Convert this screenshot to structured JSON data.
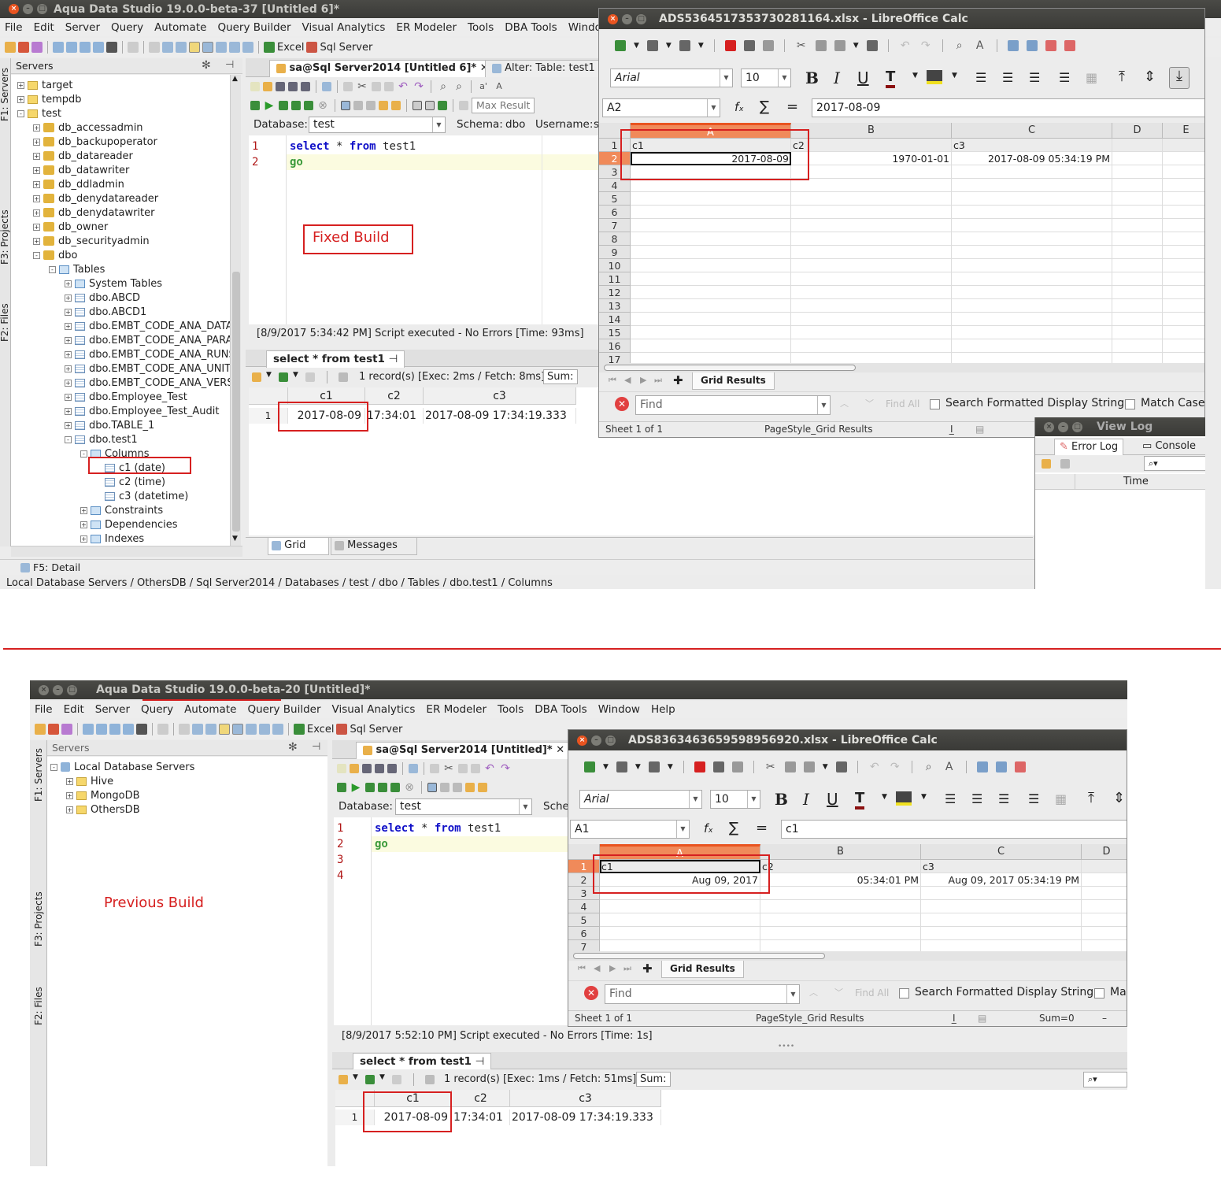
{
  "colors": {
    "red": "#d62020",
    "accent": "#e95420",
    "keyword": "#1010c8",
    "go": "#3a9a3a"
  },
  "top": {
    "ads_title": "Aqua Data Studio 19.0.0-beta-37 [Untitled 6]*",
    "menu": [
      "File",
      "Edit",
      "Server",
      "Query",
      "Automate",
      "Query Builder",
      "Visual Analytics",
      "ER Modeler",
      "Tools",
      "DBA Tools",
      "Window"
    ],
    "toolbar_excel": "Excel",
    "toolbar_sql_server": "Sql Server",
    "servers_label": "Servers",
    "side_tabs": [
      "F1: Servers",
      "F3: Projects",
      "F2: Files"
    ],
    "tree": [
      "target",
      "tempdb",
      "test",
      "db_accessadmin",
      "db_backupoperator",
      "db_datareader",
      "db_datawriter",
      "db_ddladmin",
      "db_denydatareader",
      "db_denydatawriter",
      "db_owner",
      "db_securityadmin",
      "dbo",
      "Tables",
      "System Tables",
      "dbo.ABCD",
      "dbo.ABCD1",
      "dbo.EMBT_CODE_ANA_DATA",
      "dbo.EMBT_CODE_ANA_PARA",
      "dbo.EMBT_CODE_ANA_RUNS",
      "dbo.EMBT_CODE_ANA_UNITS",
      "dbo.EMBT_CODE_ANA_VERS",
      "dbo.Employee_Test",
      "dbo.Employee_Test_Audit",
      "dbo.TABLE_1",
      "dbo.test1",
      "Columns",
      "c1 (date)",
      "c2 (time)",
      "c3 (datetime)",
      "Constraints",
      "Dependencies",
      "Indexes"
    ],
    "detail_tab": "F5: Detail",
    "breadcrumb": "Local Database Servers / OthersDB / Sql Server2014 / Databases / test / dbo / Tables / dbo.test1 / Columns",
    "editor_tab": "sa@Sql Server2014 [Untitled 6]*",
    "alter_tab": "Alter: Table: test1",
    "database_label": "Database:",
    "database_value": "test",
    "schema_label": "Schema:",
    "schema_value": "dbo",
    "username_label": "Username:",
    "username_value": "s",
    "max_results": "Max Result",
    "line_numbers": [
      "1",
      "2"
    ],
    "code_kw1": "select",
    "code_star": " * ",
    "code_kw2": "from",
    "code_tbl": " test1",
    "code_go": "go",
    "annotation": "Fixed Build",
    "exec_status": "[8/9/2017 5:34:42 PM] Script executed - No Errors [Time: 93ms]",
    "results_tab": "select * from test1",
    "records": "1 record(s) [Exec: 2ms / Fetch: 8ms]",
    "sum": "Sum:",
    "cols": [
      "c1",
      "c2",
      "c3"
    ],
    "row_num": "1",
    "row": [
      "2017-08-09",
      "17:34:01",
      "2017-08-09 17:34:19.333"
    ],
    "bottom_tabs": [
      "Grid",
      "Messages"
    ],
    "calc": {
      "title": "ADS5364517353730281164.xlsx - LibreOffice Calc",
      "font": "Arial",
      "size": "10",
      "cellref": "A2",
      "formula": "2017-08-09",
      "col_letters": [
        "A",
        "B",
        "C",
        "D",
        "E"
      ],
      "rows": [
        "1",
        "2",
        "3",
        "4",
        "5",
        "6",
        "7",
        "8",
        "9",
        "10",
        "11",
        "12",
        "13",
        "14",
        "15",
        "16",
        "17"
      ],
      "r1": [
        "c1",
        "c2",
        "c3"
      ],
      "r2": [
        "2017-08-09",
        "1970-01-01",
        "2017-08-09 05:34:19 PM"
      ],
      "sheet_tab": "Grid Results",
      "find_placeholder": "Find",
      "find_all": "Find All",
      "search_fmt": "Search Formatted Display String",
      "match_case": "Match Case",
      "sheet_of": "Sheet 1 of 1",
      "page_style": "PageStyle_Grid Results"
    },
    "viewlog": {
      "title": "View Log",
      "tabs": [
        "Error Log",
        "Console"
      ],
      "time_col": "Time"
    }
  },
  "bottom": {
    "ads_title": "Aqua Data Studio 19.0.0-beta-20 [Untitled]*",
    "menu": [
      "File",
      "Edit",
      "Server",
      "Query",
      "Automate",
      "Query Builder",
      "Visual Analytics",
      "ER Modeler",
      "Tools",
      "DBA Tools",
      "Window",
      "Help"
    ],
    "toolbar_excel": "Excel",
    "toolbar_sql_server": "Sql Server",
    "servers_label": "Servers",
    "side_tabs": [
      "F1: Servers",
      "F3: Projects",
      "F2: Files"
    ],
    "tree": [
      "Local Database Servers",
      "Hive",
      "MongoDB",
      "OthersDB"
    ],
    "editor_tab": "sa@Sql Server2014 [Untitled]*",
    "database_label": "Database:",
    "database_value": "test",
    "schema_short": "Sche",
    "line_numbers": [
      "1",
      "2",
      "3",
      "4"
    ],
    "code_kw1": "select",
    "code_star": " * ",
    "code_kw2": "from",
    "code_tbl": " test1",
    "code_go": "go",
    "annotation": "Previous Build",
    "exec_status": "[8/9/2017 5:52:10 PM] Script executed - No Errors [Time: 1s]",
    "results_tab": "select * from test1",
    "records": "1 record(s) [Exec: 1ms / Fetch: 51ms]",
    "sum": "Sum:",
    "cols": [
      "c1",
      "c2",
      "c3"
    ],
    "row_num": "1",
    "row": [
      "2017-08-09",
      "17:34:01",
      "2017-08-09 17:34:19.333"
    ],
    "calc": {
      "title": "ADS8363463659598956920.xlsx - LibreOffice Calc",
      "font": "Arial",
      "size": "10",
      "cellref": "A1",
      "formula": "c1",
      "col_letters": [
        "A",
        "B",
        "C",
        "D"
      ],
      "rows": [
        "1",
        "2",
        "3",
        "4",
        "5",
        "6",
        "7"
      ],
      "r1": [
        "c1",
        "c2",
        "c3"
      ],
      "r2": [
        "Aug 09, 2017",
        "05:34:01 PM",
        "Aug 09, 2017 05:34:19 PM"
      ],
      "sheet_tab": "Grid Results",
      "find_placeholder": "Find",
      "find_all": "Find All",
      "search_fmt": "Search Formatted Display String",
      "match_case": "Ma",
      "sheet_of": "Sheet 1 of 1",
      "page_style": "PageStyle_Grid Results",
      "sum": "Sum=0"
    }
  }
}
